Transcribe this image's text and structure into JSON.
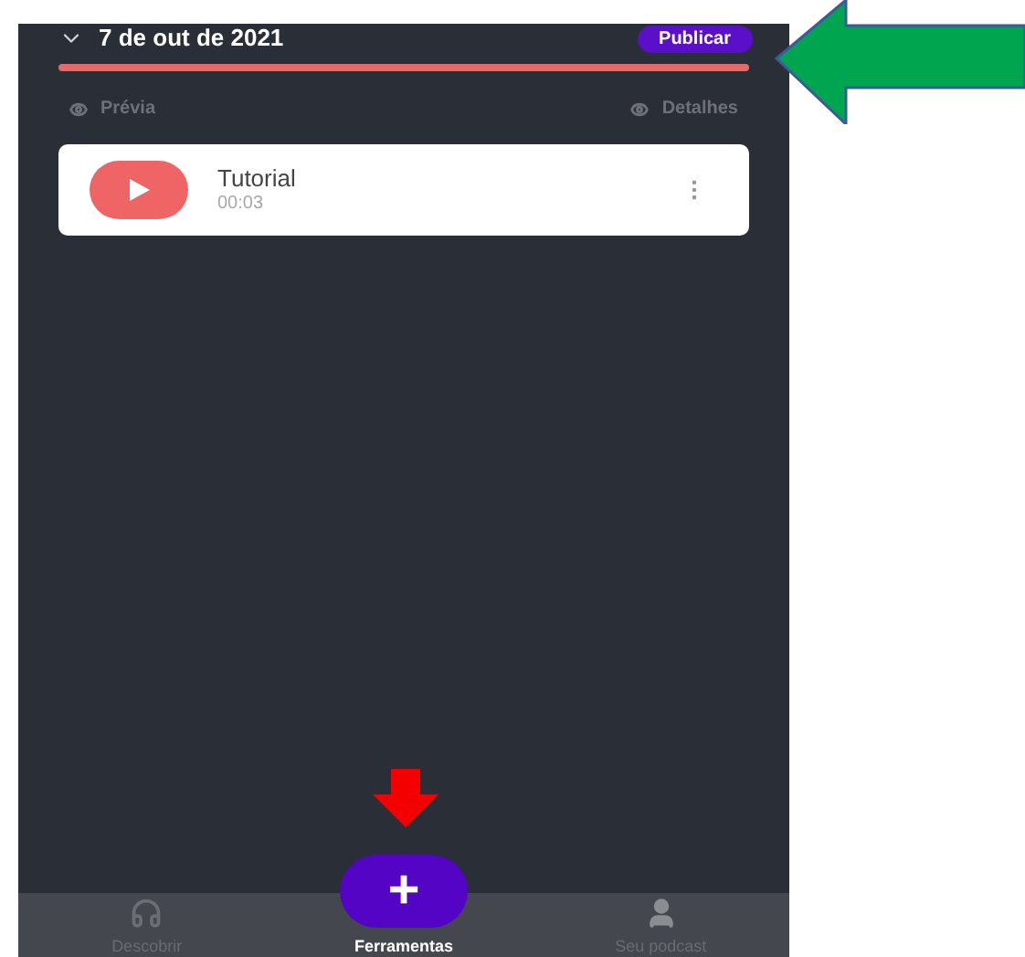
{
  "header": {
    "date": "7 de out de 2021",
    "publish_button": "Publicar"
  },
  "links": [
    {
      "label": "Prévia"
    },
    {
      "label": "Detalhes"
    }
  ],
  "episodes": [
    {
      "title": "Tutorial",
      "duration": "00:03"
    }
  ],
  "fab": {
    "label": "+"
  },
  "nav": [
    {
      "label": "Descobrir",
      "kind": "headphones",
      "selected": false
    },
    {
      "label": "Ferramentas",
      "kind": "plain",
      "selected": true
    },
    {
      "label": "Seu podcast",
      "kind": "user",
      "selected": false
    }
  ]
}
